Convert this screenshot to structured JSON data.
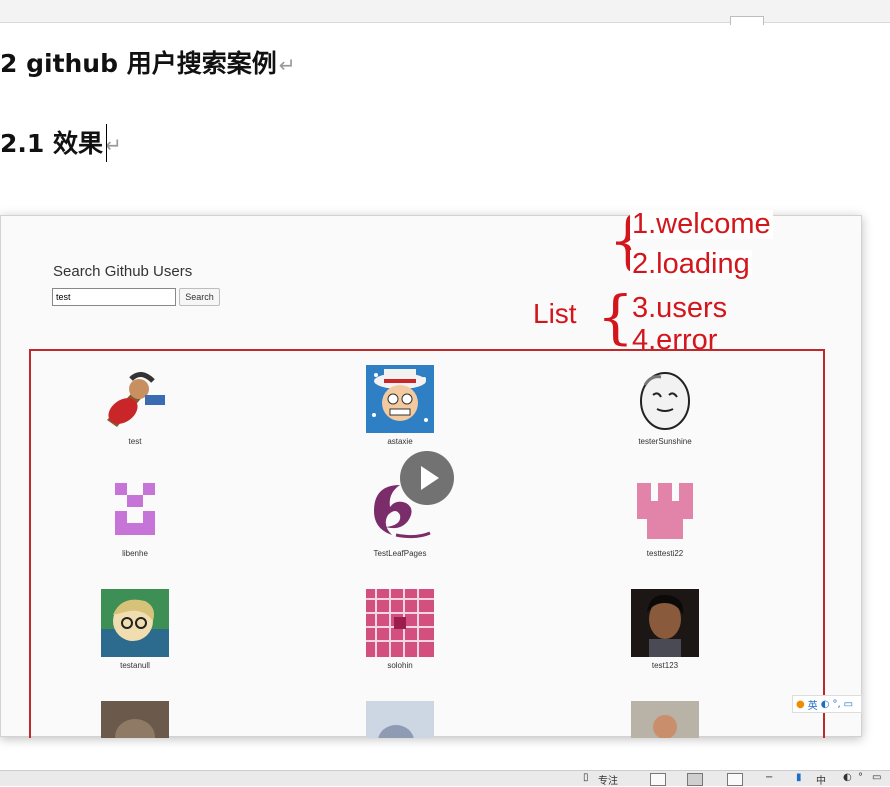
{
  "document": {
    "heading_2": "2 github 用户搜索案例",
    "heading_3": "2.1 效果",
    "paragraph_mark": "↵"
  },
  "screenshot": {
    "search_title": "Search Github Users",
    "search_value": "test",
    "search_button": "Search",
    "users": [
      {
        "name": "test"
      },
      {
        "name": "astaxie"
      },
      {
        "name": "testerSunshine"
      },
      {
        "name": "libenhe"
      },
      {
        "name": "TestLeafPages"
      },
      {
        "name": "testtesti22"
      },
      {
        "name": "testanull"
      },
      {
        "name": "solohin"
      },
      {
        "name": "test123"
      },
      {
        "name": ""
      },
      {
        "name": ""
      },
      {
        "name": ""
      }
    ]
  },
  "annotations": {
    "list_label": "List",
    "states": [
      "1.welcome",
      "2.loading",
      "3.users",
      "4.error"
    ],
    "color": "#d3161c"
  },
  "ime": {
    "label": "英"
  },
  "status_bar": {
    "focus_label": "专注",
    "lang": "中"
  }
}
